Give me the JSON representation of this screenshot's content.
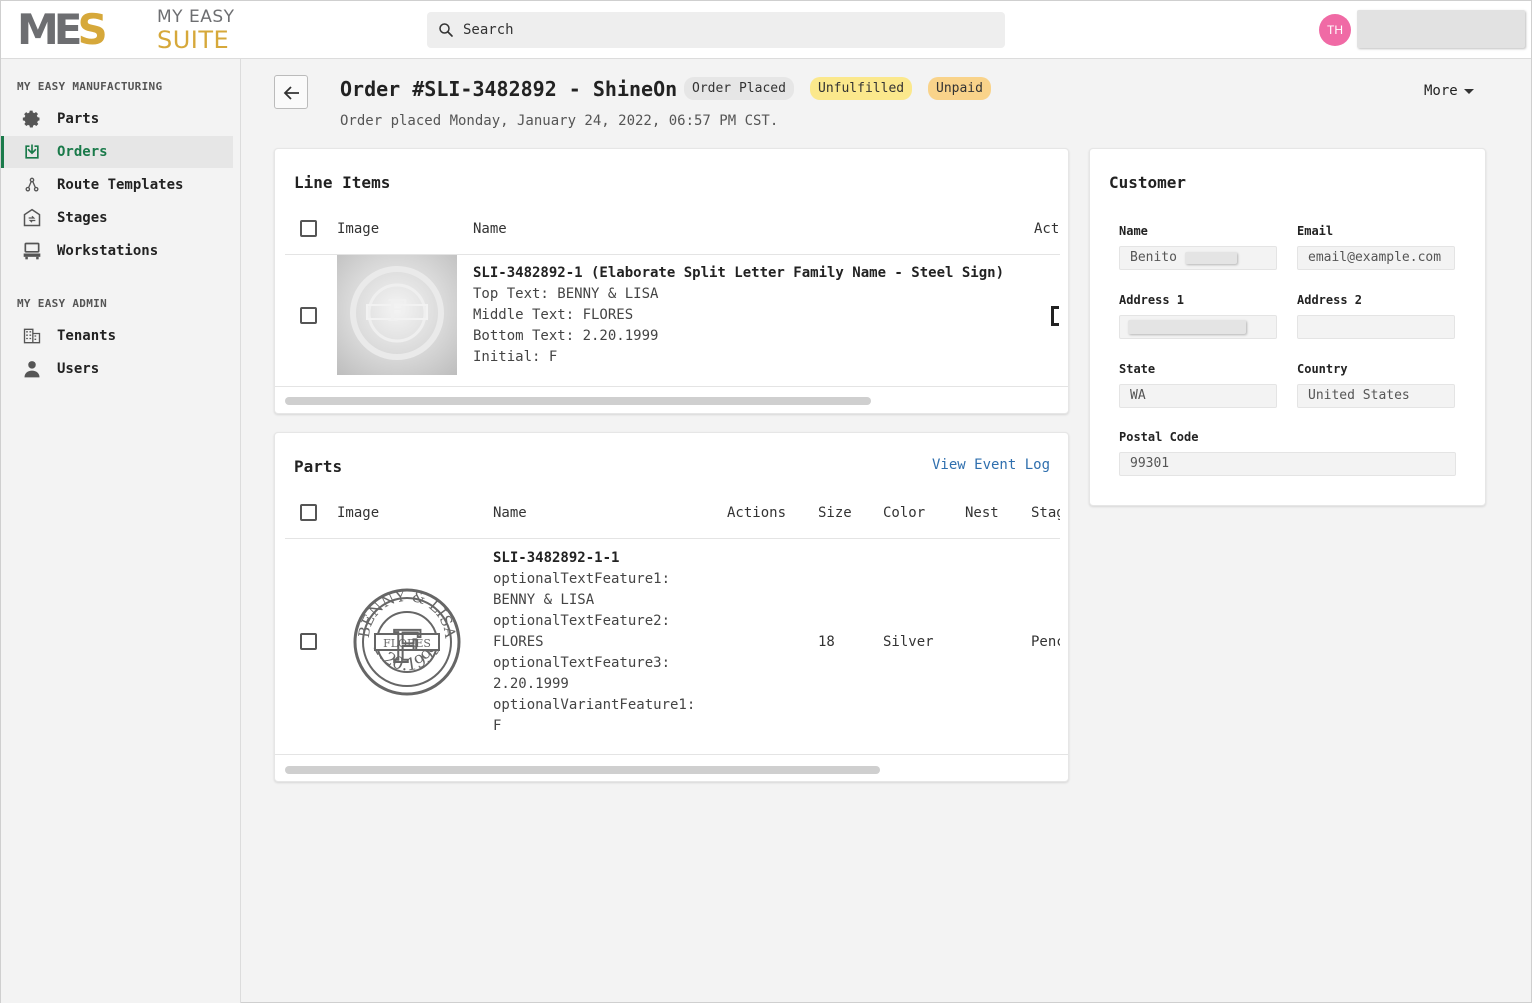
{
  "logo": {
    "mark": "MES",
    "line1": "MY EASY",
    "line2": "SUITE"
  },
  "search": {
    "placeholder": "Search"
  },
  "user": {
    "initials": "TH"
  },
  "sidebar": {
    "section1": "MY EASY MANUFACTURING",
    "section2": "MY EASY ADMIN",
    "items": [
      {
        "label": "Parts",
        "icon": "gear-icon"
      },
      {
        "label": "Orders",
        "icon": "download-box-icon"
      },
      {
        "label": "Route Templates",
        "icon": "route-icon"
      },
      {
        "label": "Stages",
        "icon": "stages-icon"
      },
      {
        "label": "Workstations",
        "icon": "workstation-icon"
      }
    ],
    "admin_items": [
      {
        "label": "Tenants",
        "icon": "building-icon"
      },
      {
        "label": "Users",
        "icon": "user-icon"
      }
    ],
    "active": "Orders"
  },
  "order": {
    "title": "Order #SLI-3482892 - ShineOn",
    "badges": [
      "Order Placed",
      "Unfulfilled",
      "Unpaid"
    ],
    "subtitle": "Order placed Monday, January 24, 2022, 06:57 PM CST.",
    "more_label": "More"
  },
  "line_items": {
    "title": "Line Items",
    "columns": [
      "Image",
      "Name",
      "Act"
    ],
    "rows": [
      {
        "name": "SLI-3482892-1 (Elaborate Split Letter Family Name - Steel Sign)",
        "details": [
          "Top Text: BENNY & LISA",
          "Middle Text: FLORES",
          "Bottom Text: 2.20.1999",
          "Initial: F"
        ]
      }
    ]
  },
  "parts": {
    "title": "Parts",
    "event_log_link": "View Event Log",
    "columns": [
      "Image",
      "Name",
      "Actions",
      "Size",
      "Color",
      "Nest",
      "Stag"
    ],
    "rows": [
      {
        "name": "SLI-3482892-1-1",
        "details": [
          "optionalTextFeature1:",
          "BENNY & LISA",
          "optionalTextFeature2:",
          "FLORES",
          "optionalTextFeature3:",
          "2.20.1999",
          "optionalVariantFeature1:",
          "F"
        ],
        "size": "18",
        "color": "Silver",
        "nest": "",
        "stage": "Penc",
        "sign_text": {
          "top": "BENNY & LISA",
          "middle": "FLORES",
          "bottom": "2.20.1999",
          "initial": "F"
        }
      }
    ]
  },
  "customer": {
    "title": "Customer",
    "labels": {
      "name": "Name",
      "email": "Email",
      "address1": "Address 1",
      "address2": "Address 2",
      "state": "State",
      "country": "Country",
      "postal": "Postal Code"
    },
    "values": {
      "name": "Benito",
      "email": "email@example.com",
      "address1": "",
      "address2": "",
      "state": "WA",
      "country": "United States",
      "postal": "99301"
    }
  }
}
